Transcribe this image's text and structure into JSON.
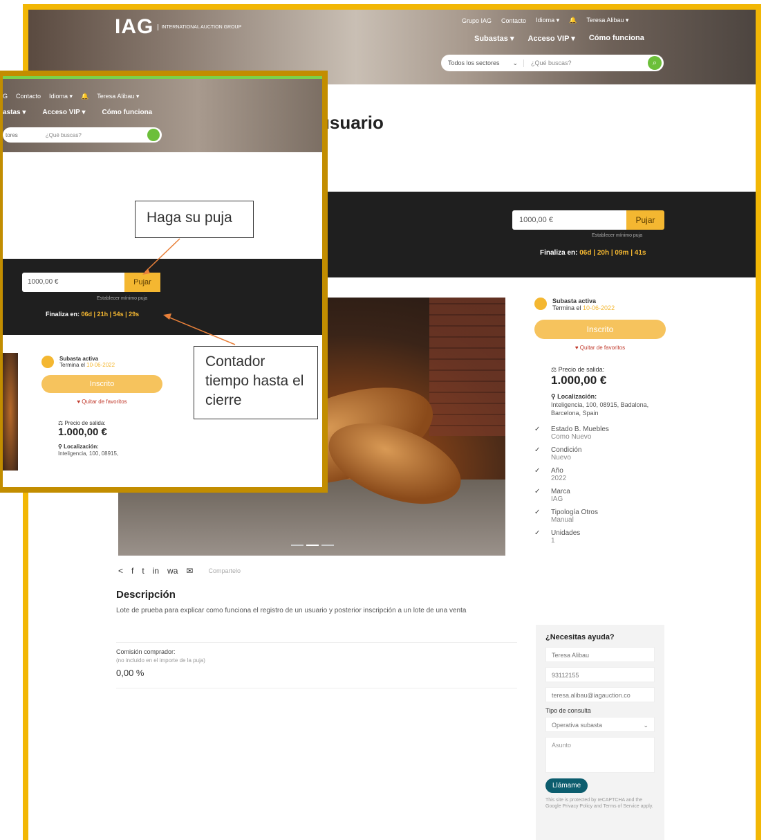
{
  "header": {
    "logo_main": "IAG",
    "logo_sub": "International Auction Group",
    "topnav": [
      "Grupo IAG",
      "Contacto",
      "Idioma ▾",
      "Teresa Alibau ▾"
    ],
    "mainnav": [
      "Subastas ▾",
      "Acceso VIP ▾",
      "Cómo funciona"
    ],
    "sector": "Todos los sectores",
    "search_placeholder": "¿Qué buscas?"
  },
  "page_title": "usuario",
  "bid": {
    "amount": "1000,00 €",
    "button": "Pujar",
    "min_note": "Establecer mínimo puja",
    "finaliza_label": "Finaliza en:",
    "countdown": "06d | 20h | 09m | 41s"
  },
  "lot": {
    "status": "Subasta activa",
    "ends_label": "Termina el",
    "ends_date": "10-06-2022",
    "inscrito": "Inscrito",
    "fav": "Quitar de favoritos",
    "price_label": "Precio de salida:",
    "price_value": "1.000,00 €",
    "loc_label": "Localización:",
    "loc_value": "Inteligencia, 100, 08915, Badalona, Barcelona, Spain",
    "features": [
      {
        "name": "Estado B. Muebles",
        "value": "Como Nuevo"
      },
      {
        "name": "Condición",
        "value": "Nuevo"
      },
      {
        "name": "Año",
        "value": "2022"
      },
      {
        "name": "Marca",
        "value": "IAG"
      },
      {
        "name": "Tipología Otros",
        "value": "Manual"
      },
      {
        "name": "Unidades",
        "value": "1"
      }
    ]
  },
  "share": {
    "icons": [
      "<",
      "f",
      "t",
      "in",
      "wa",
      "✉"
    ],
    "label": "Compartelo"
  },
  "description": {
    "title": "Descripción",
    "text": "Lote de prueba para explicar como funciona el registro de un usuario y posterior inscripción a un lote de una venta"
  },
  "commission": {
    "label": "Comisión comprador:",
    "note": "(no incluido en el importe de la puja)",
    "value": "0,00 %"
  },
  "help": {
    "title": "¿Necesitas ayuda?",
    "name": "Teresa Alibau",
    "phone": "93112155",
    "email": "teresa.alibau@iagauction.co",
    "type_label": "Tipo de consulta",
    "type_value": "Operativa subasta",
    "subject_placeholder": "Asunto",
    "call_button": "Llámame",
    "recaptcha": "This site is protected by reCAPTCHA and the Google Privacy Policy and Terms of Service apply."
  },
  "zoom": {
    "topnav": [
      "G",
      "Contacto",
      "Idioma ▾",
      "Teresa Alibau ▾"
    ],
    "mainnav": [
      "astas ▾",
      "Acceso VIP ▾",
      "Cómo funciona"
    ],
    "sector": "tores",
    "search_placeholder": "¿Qué buscas?",
    "countdown": "06d | 21h | 54s | 29s",
    "loc_value": "Inteligencia, 100, 08915,"
  },
  "callouts": {
    "bid": "Haga su puja",
    "countdown": "Contador tiempo hasta el cierre"
  },
  "colors": {
    "accent": "#f4b731",
    "frame": "#f2b705",
    "zoom_frame": "#c28d00",
    "dark": "#1f1f1f",
    "call": "#0c5d6e"
  }
}
